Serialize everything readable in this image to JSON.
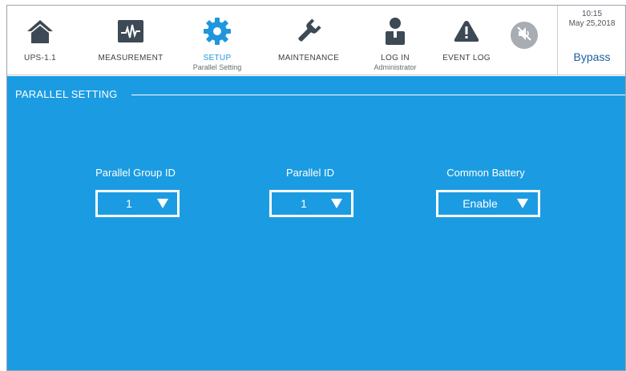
{
  "nav": {
    "items": [
      {
        "label": "UPS-1.1",
        "sub": "",
        "icon": "home-icon"
      },
      {
        "label": "MEASUREMENT",
        "sub": "",
        "icon": "waveform-monitor-icon"
      },
      {
        "label": "SETUP",
        "sub": "Parallel Setting",
        "icon": "gear-icon",
        "active": true
      },
      {
        "label": "MAINTENANCE",
        "sub": "",
        "icon": "wrench-icon"
      },
      {
        "label": "LOG IN",
        "sub": "Administrator",
        "icon": "user-icon"
      },
      {
        "label": "EVENT LOG",
        "sub": "",
        "icon": "warning-icon"
      }
    ],
    "mute_icon": "speaker-muted-icon"
  },
  "status": {
    "time": "10:15",
    "date": "May 25,2018",
    "mode": "Bypass"
  },
  "section": {
    "title": "PARALLEL SETTING"
  },
  "fields": {
    "group_id": {
      "label": "Parallel Group ID",
      "value": "1"
    },
    "parallel_id": {
      "label": "Parallel ID",
      "value": "1"
    },
    "common_battery": {
      "label": "Common Battery",
      "value": "Enable"
    }
  },
  "colors": {
    "accent": "#1b9ce2",
    "icon_dark": "#3d4954",
    "active_blue": "#1f96dd",
    "mute_gray": "#a7adb2"
  }
}
